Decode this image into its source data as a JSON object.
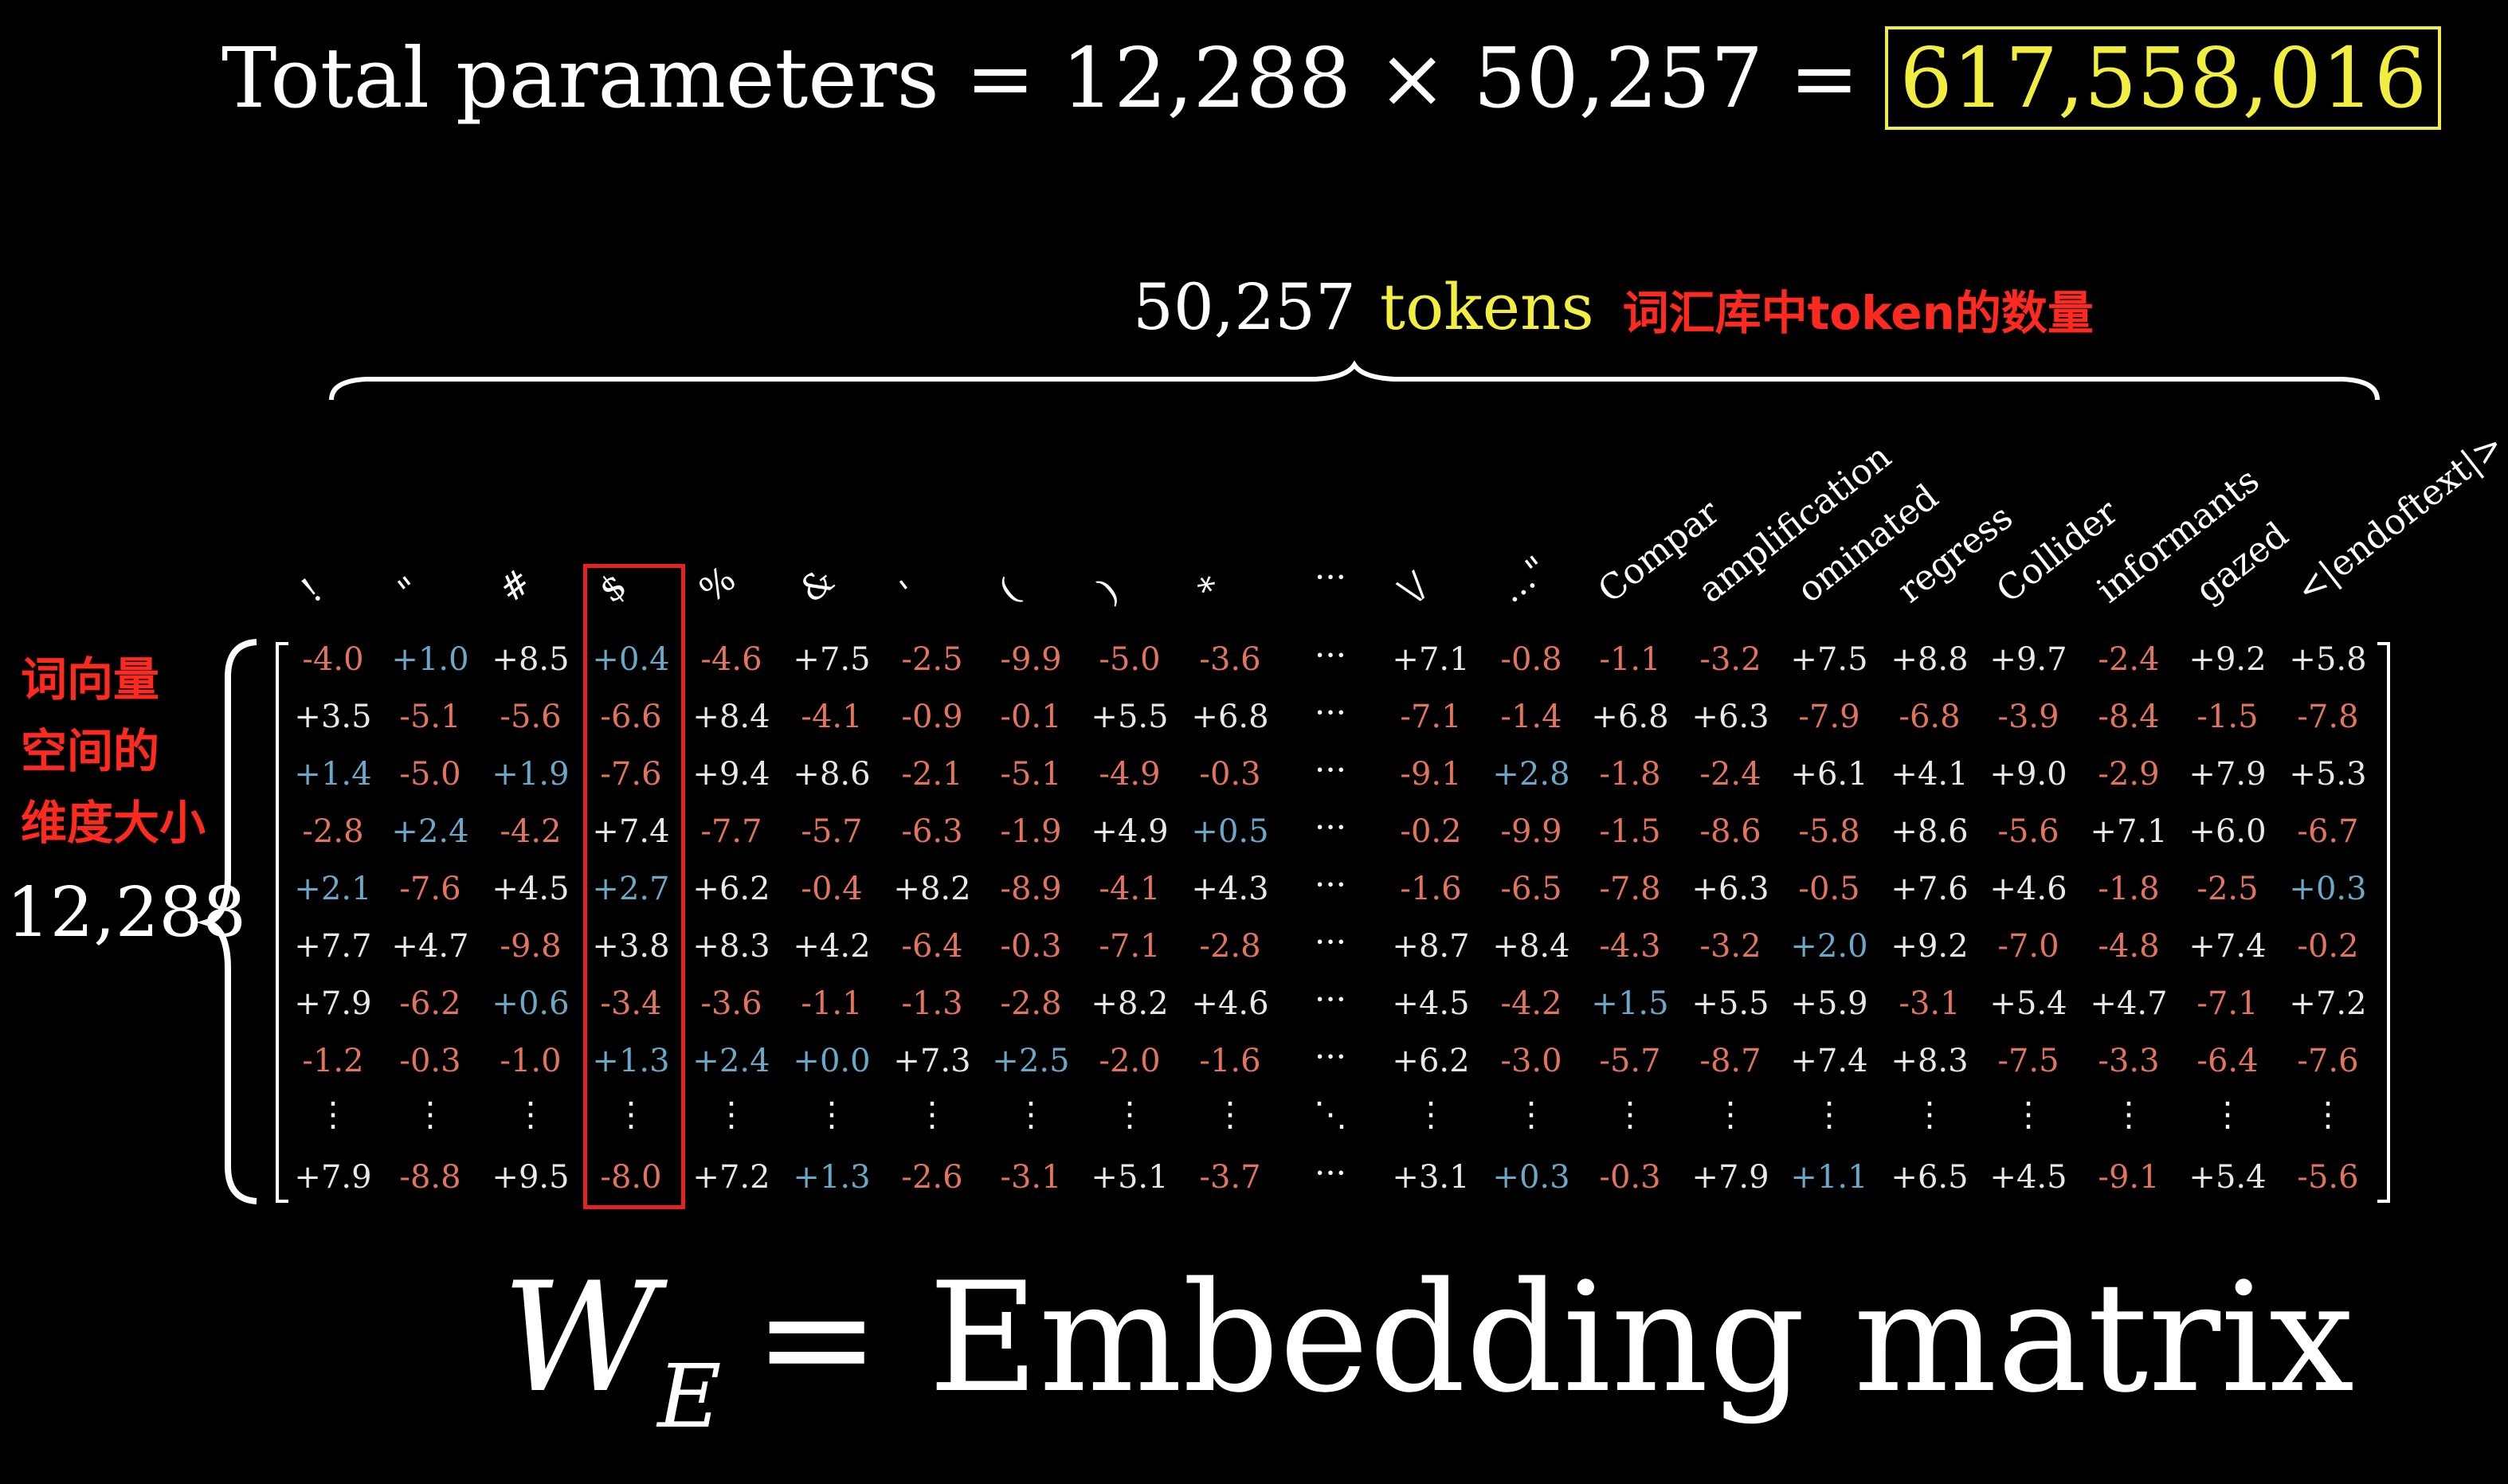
{
  "title": {
    "prefix": "Total parameters = 12,288 × 50,257 = ",
    "result": "617,558,016"
  },
  "vocab_label": {
    "count": "50,257",
    "word": "tokens",
    "note": "词汇库中token的数量"
  },
  "dim_label": {
    "note_lines": [
      "词向量",
      "空间的",
      "维度大小"
    ],
    "count": "12,288"
  },
  "formula": {
    "symbol": "W",
    "subscript": "E",
    "rest": "= Embedding matrix"
  },
  "colors": {
    "positive": "#6aa8c8",
    "negative": "#e2745e",
    "neutral": "#e8e8e8",
    "highlight_yellow": "#f2ee3f",
    "annotation_red": "#ff2a1f"
  },
  "matrix": {
    "highlighted_column_index": 3,
    "tokens_left": [
      "!",
      "\"",
      "#",
      "$",
      "%",
      "&",
      "'",
      "(",
      ")",
      "*"
    ],
    "tokens_right": [
      "\\/",
      "...\"",
      "Compar",
      "amplification",
      "ominated",
      "regress",
      "Collider",
      "informants",
      "gazed",
      "<|endoftext|>"
    ],
    "rows_left": [
      [
        "-4.0",
        "+1.0",
        "+8.5",
        "+0.4",
        "-4.6",
        "+7.5",
        "-2.5",
        "-9.9",
        "-5.0",
        "-3.6"
      ],
      [
        "+3.5",
        "-5.1",
        "-5.6",
        "-6.6",
        "+8.4",
        "-4.1",
        "-0.9",
        "-0.1",
        "+5.5",
        "+6.8"
      ],
      [
        "+1.4",
        "-5.0",
        "+1.9",
        "-7.6",
        "+9.4",
        "+8.6",
        "-2.1",
        "-5.1",
        "-4.9",
        "-0.3"
      ],
      [
        "-2.8",
        "+2.4",
        "-4.2",
        "+7.4",
        "-7.7",
        "-5.7",
        "-6.3",
        "-1.9",
        "+4.9",
        "+0.5"
      ],
      [
        "+2.1",
        "-7.6",
        "+4.5",
        "+2.7",
        "+6.2",
        "-0.4",
        "+8.2",
        "-8.9",
        "-4.1",
        "+4.3"
      ],
      [
        "+7.7",
        "+4.7",
        "-9.8",
        "+3.8",
        "+8.3",
        "+4.2",
        "-6.4",
        "-0.3",
        "-7.1",
        "-2.8"
      ],
      [
        "+7.9",
        "-6.2",
        "+0.6",
        "-3.4",
        "-3.6",
        "-1.1",
        "-1.3",
        "-2.8",
        "+8.2",
        "+4.6"
      ],
      [
        "-1.2",
        "-0.3",
        "-1.0",
        "+1.3",
        "+2.4",
        "+0.0",
        "+7.3",
        "+2.5",
        "-2.0",
        "-1.6"
      ],
      [
        "+7.9",
        "-8.8",
        "+9.5",
        "-8.0",
        "+7.2",
        "+1.3",
        "-2.6",
        "-3.1",
        "+5.1",
        "-3.7"
      ]
    ],
    "rows_right": [
      [
        "+7.1",
        "-0.8",
        "-1.1",
        "-3.2",
        "+7.5",
        "+8.8",
        "+9.7",
        "-2.4",
        "+9.2",
        "+5.8"
      ],
      [
        "-7.1",
        "-1.4",
        "+6.8",
        "+6.3",
        "-7.9",
        "-6.8",
        "-3.9",
        "-8.4",
        "-1.5",
        "-7.8"
      ],
      [
        "-9.1",
        "+2.8",
        "-1.8",
        "-2.4",
        "+6.1",
        "+4.1",
        "+9.0",
        "-2.9",
        "+7.9",
        "+5.3"
      ],
      [
        "-0.2",
        "-9.9",
        "-1.5",
        "-8.6",
        "-5.8",
        "+8.6",
        "-5.6",
        "+7.1",
        "+6.0",
        "-6.7"
      ],
      [
        "-1.6",
        "-6.5",
        "-7.8",
        "+6.3",
        "-0.5",
        "+7.6",
        "+4.6",
        "-1.8",
        "-2.5",
        "+0.3"
      ],
      [
        "+8.7",
        "+8.4",
        "-4.3",
        "-3.2",
        "+2.0",
        "+9.2",
        "-7.0",
        "-4.8",
        "+7.4",
        "-0.2"
      ],
      [
        "+4.5",
        "-4.2",
        "+1.5",
        "+5.5",
        "+5.9",
        "-3.1",
        "+5.4",
        "+4.7",
        "-7.1",
        "+7.2"
      ],
      [
        "+6.2",
        "-3.0",
        "-5.7",
        "-8.7",
        "+7.4",
        "+8.3",
        "-7.5",
        "-3.3",
        "-6.4",
        "-7.6"
      ],
      [
        "+3.1",
        "+0.3",
        "-0.3",
        "+7.9",
        "+1.1",
        "+6.5",
        "+4.5",
        "-9.1",
        "+5.4",
        "-5.6"
      ]
    ]
  }
}
